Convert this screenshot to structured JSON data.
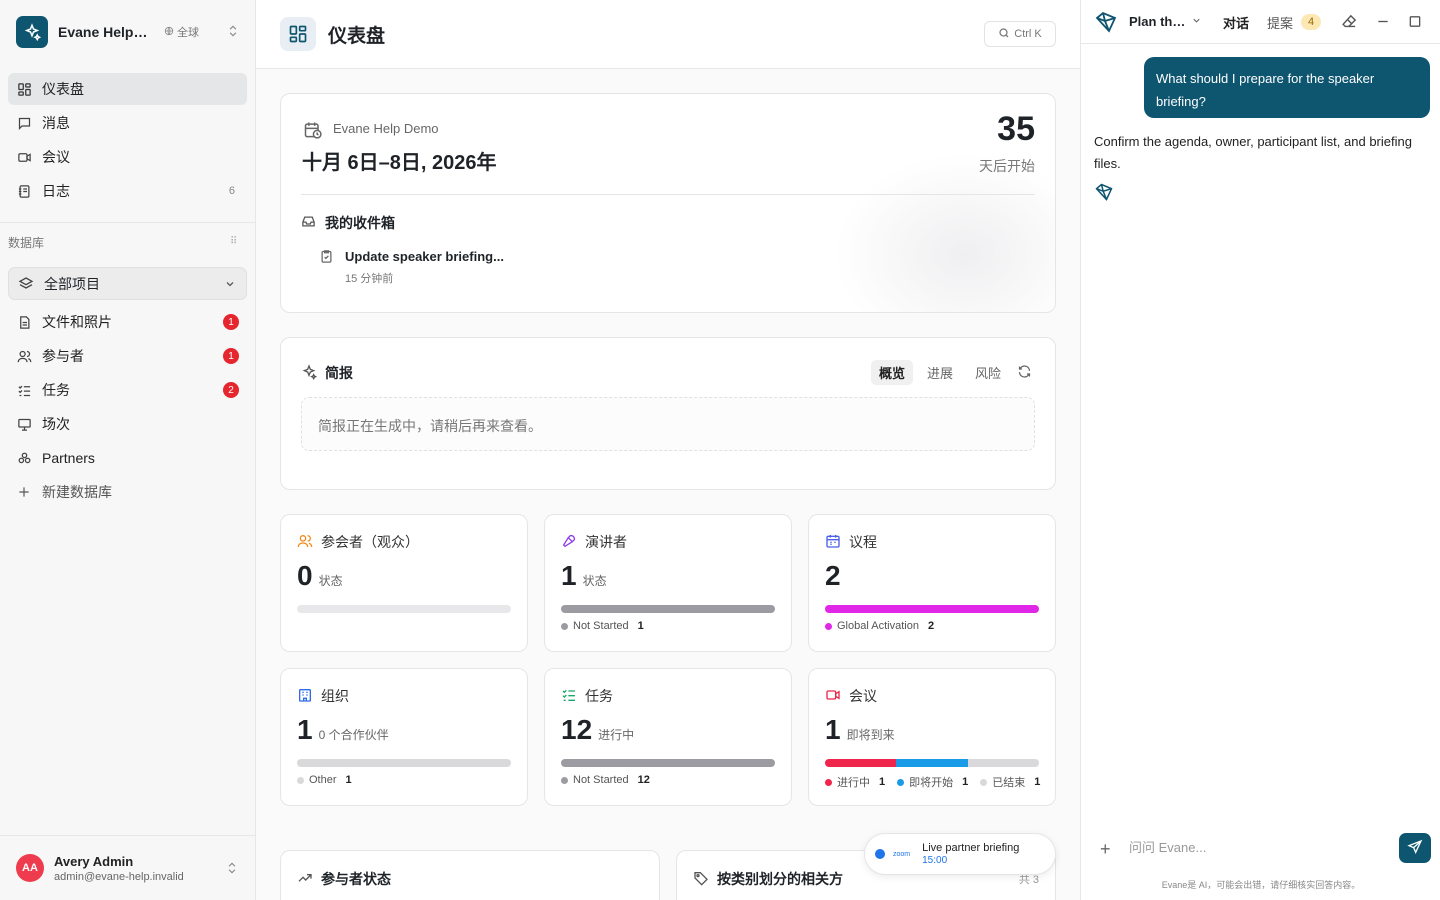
{
  "sidebar": {
    "workspace_name": "Evane Help Demo",
    "workspace_scope": "全球",
    "nav": [
      {
        "label": "仪表盘"
      },
      {
        "label": "消息"
      },
      {
        "label": "会议"
      },
      {
        "label": "日志",
        "count": "6"
      }
    ],
    "section_label": "数据库",
    "db_select": "全部项目",
    "db_items": [
      {
        "label": "文件和照片",
        "badge": "1"
      },
      {
        "label": "参与者",
        "badge": "1"
      },
      {
        "label": "任务",
        "badge": "2"
      },
      {
        "label": "场次"
      },
      {
        "label": "Partners"
      }
    ],
    "new_db": "新建数据库",
    "user": {
      "initials": "AA",
      "name": "Avery Admin",
      "email": "admin@evane-help.invalid"
    }
  },
  "header": {
    "title": "仪表盘",
    "search_shortcut": "Ctrl K"
  },
  "event": {
    "name": "Evane Help Demo",
    "dates": "十月 6日–8日, 2026年",
    "days_until": "35",
    "days_label": "天后开始",
    "inbox_title": "我的收件箱",
    "inbox_item": {
      "title": "Update speaker briefing...",
      "time": "15 分钟前"
    }
  },
  "briefing": {
    "title": "简报",
    "tabs": [
      "概览",
      "进展",
      "风险"
    ],
    "message": "简报正在生成中，请稍后再来查看。"
  },
  "stats": [
    {
      "title": "参会者（观众）",
      "value": "0",
      "unit": "状态",
      "segments": [],
      "legend": []
    },
    {
      "title": "演讲者",
      "value": "1",
      "unit": "状态",
      "segments": [
        {
          "color": "#9b9ba1",
          "frac": 1
        }
      ],
      "legend": [
        {
          "label": "Not Started",
          "count": "1",
          "color": "#9b9ba1"
        }
      ]
    },
    {
      "title": "议程",
      "value": "2",
      "unit": "",
      "segments": [
        {
          "color": "#e027e8",
          "frac": 1
        }
      ],
      "legend": [
        {
          "label": "Global Activation",
          "count": "2",
          "color": "#e027e8"
        }
      ]
    },
    {
      "title": "组织",
      "value": "1",
      "unit": "0 个合作伙伴",
      "segments": [
        {
          "color": "#d9d9dc",
          "frac": 1
        }
      ],
      "legend": [
        {
          "label": "Other",
          "count": "1",
          "color": "#d9d9dc"
        }
      ]
    },
    {
      "title": "任务",
      "value": "12",
      "unit": "进行中",
      "segments": [
        {
          "color": "#9b9ba1",
          "frac": 1
        }
      ],
      "legend": [
        {
          "label": "Not Started",
          "count": "12",
          "color": "#9b9ba1"
        }
      ]
    },
    {
      "title": "会议",
      "value": "1",
      "unit": "即将到来",
      "segments": [
        {
          "color": "#f0254c",
          "frac": 0.333
        },
        {
          "color": "#1a9be8",
          "frac": 0.333
        },
        {
          "color": "#d9d9dc",
          "frac": 0.334
        }
      ],
      "legend": [
        {
          "label": "进行中",
          "count": "1",
          "color": "#f0254c"
        },
        {
          "label": "即将开始",
          "count": "1",
          "color": "#1a9be8"
        },
        {
          "label": "已结束",
          "count": "1",
          "color": "#d9d9dc"
        }
      ]
    }
  ],
  "bottom": {
    "left_title": "参与者状态",
    "right_title": "按类别划分的相关方",
    "right_extra": "共 3"
  },
  "toast": {
    "title": "Live partner briefing",
    "time": "15:00",
    "app": "zoom"
  },
  "panel": {
    "title": "Plan the event",
    "tab_chat": "对话",
    "tab_proposals": "提案",
    "proposals_count": "4",
    "user_msg": "What should I prepare for the speaker briefing?",
    "ai_msg": "Confirm the agenda, owner, participant list, and briefing files.",
    "input_placeholder": "问问 Evane...",
    "disclaimer": "Evane是 AI，可能会出错，请仔细核实回答内容。"
  }
}
